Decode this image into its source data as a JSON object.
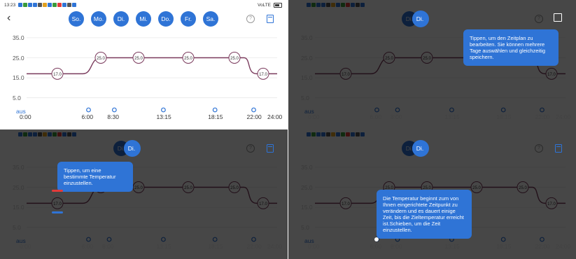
{
  "colors": {
    "accent": "#2f74d6",
    "curve": "#7a3a5c",
    "marker_red": "#e23b3b"
  },
  "panels": [
    {
      "time": "13:23",
      "dimmed": false,
      "selected_day": "Di."
    },
    {
      "time": "13:22",
      "dimmed": true,
      "selected_day": "Di.",
      "tip": "Tippen, um den Zeitplan zu bearbeiten. Sie können mehrere Tage auswählen und gleichzeitig speichern."
    },
    {
      "time": "13:22",
      "dimmed": true,
      "selected_day": "Di.",
      "tip": "Tippen, um eine bestimmte Temperatur einzustellen."
    },
    {
      "time": "13:22",
      "dimmed": true,
      "selected_day": "Di.",
      "tip": "Die Temperatur beginnt zum von Ihnen eingerichtete Zeitpunkt zu verändern und es dauert einige Zeit, bis die Zieltemperatur erreicht ist.Schieben, um die Zeit einzustellen."
    }
  ],
  "status": {
    "network": "VoLTE"
  },
  "days": [
    "So.",
    "Mo.",
    "Di.",
    "Mi.",
    "Do.",
    "Fr.",
    "Sa."
  ],
  "icons": {
    "back": "back-arrow-icon",
    "help": "help-icon",
    "save": "save-icon",
    "edit": "edit-icon"
  },
  "y_ticks": [
    "35.0",
    "25.0",
    "15.0",
    "5.0"
  ],
  "off_label": "aus",
  "time_labels": [
    "0:00",
    "6:00",
    "8:30",
    "13:15",
    "18:15",
    "22:00",
    "24:00"
  ],
  "time_labels_dim": [
    "0:00",
    "6:00",
    "8:00",
    "13:15",
    "18:15",
    "22:00",
    "24:00"
  ],
  "temp_markers": [
    "17.0",
    "25.0",
    "25.0",
    "25.0",
    "25.0",
    "17.0"
  ],
  "chart_data": {
    "type": "line",
    "x": [
      "0:00",
      "6:00",
      "8:30",
      "13:15",
      "18:15",
      "22:00",
      "24:00"
    ],
    "values": [
      17.0,
      17.0,
      25.0,
      25.0,
      25.0,
      25.0,
      17.0
    ],
    "ylim": [
      0,
      35
    ]
  }
}
